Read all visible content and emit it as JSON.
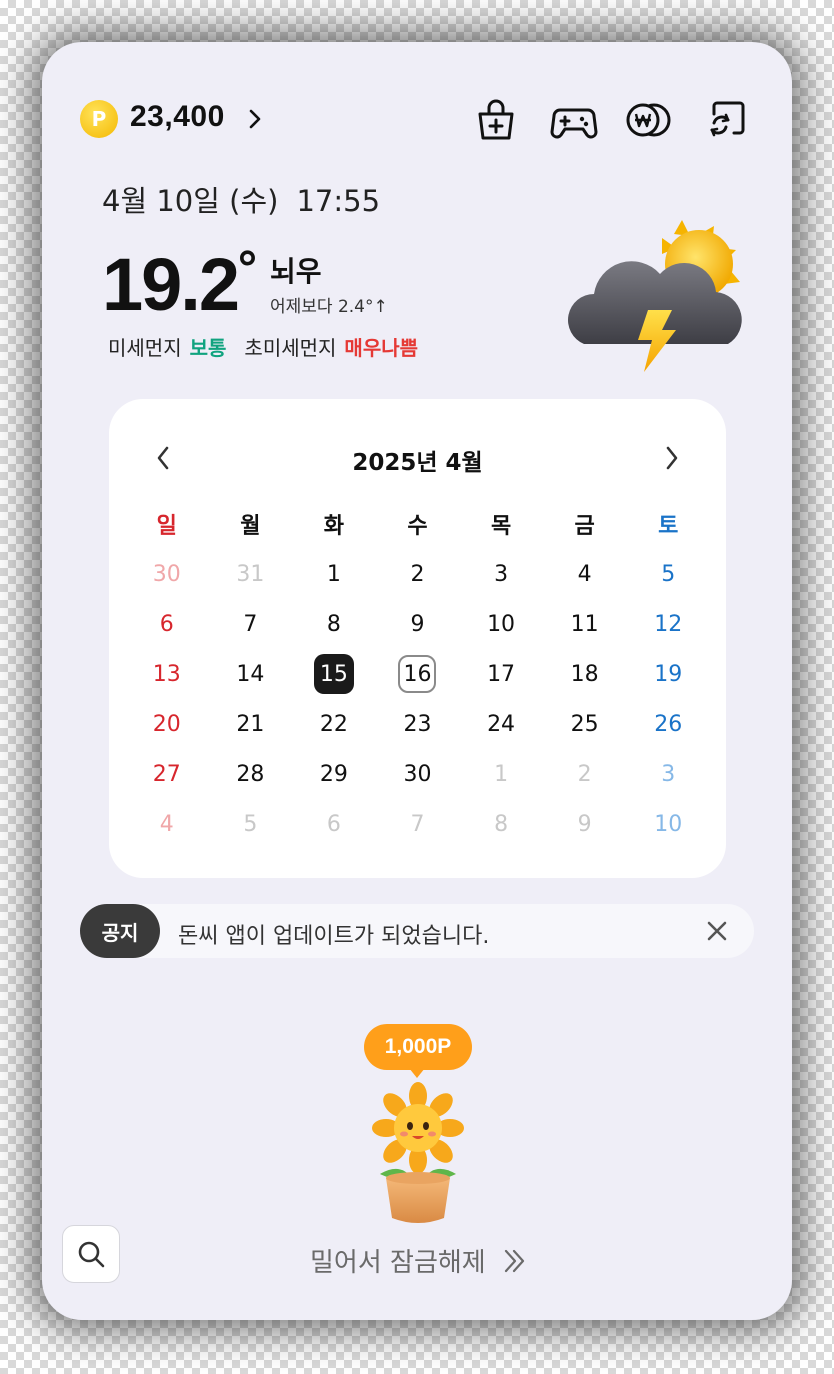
{
  "header": {
    "coin_letter": "P",
    "points": "23,400",
    "icons": [
      "shop-bag-icon",
      "gamepad-icon",
      "won-coins-icon",
      "refresh-screen-icon"
    ]
  },
  "weather": {
    "date": "4월 10일 (수)",
    "time": "17:55",
    "temperature": "19.2",
    "degree_symbol": "°",
    "condition": "뇌우",
    "vs_yesterday": "어제보다 2.4°↑",
    "fine_dust_label": "미세먼지",
    "fine_dust_value": "보통",
    "ultrafine_dust_label": "초미세먼지",
    "ultrafine_dust_value": "매우나쁨",
    "icon": "thunderstorm-icon"
  },
  "calendar": {
    "title": "2025년 4월",
    "weekdays": [
      "일",
      "월",
      "화",
      "수",
      "목",
      "금",
      "토"
    ],
    "weeks": [
      [
        "30",
        "31",
        "1",
        "2",
        "3",
        "4",
        "5"
      ],
      [
        "6",
        "7",
        "8",
        "9",
        "10",
        "11",
        "12"
      ],
      [
        "13",
        "14",
        "15",
        "16",
        "17",
        "18",
        "19"
      ],
      [
        "20",
        "21",
        "22",
        "23",
        "24",
        "25",
        "26"
      ],
      [
        "27",
        "28",
        "29",
        "30",
        "1",
        "2",
        "3"
      ],
      [
        "4",
        "5",
        "6",
        "7",
        "8",
        "9",
        "10"
      ]
    ],
    "today": "15",
    "selected": "16",
    "colors": {
      "sunday": "#d7262d",
      "saturday": "#1a73c8"
    }
  },
  "notice": {
    "tag": "공지",
    "text": "돈씨 앱이 업데이트가 되었습니다."
  },
  "reward": {
    "bubble": "1,000P",
    "unlock_text": "밀어서 잠금해제",
    "accent": "#ff9f1a"
  }
}
